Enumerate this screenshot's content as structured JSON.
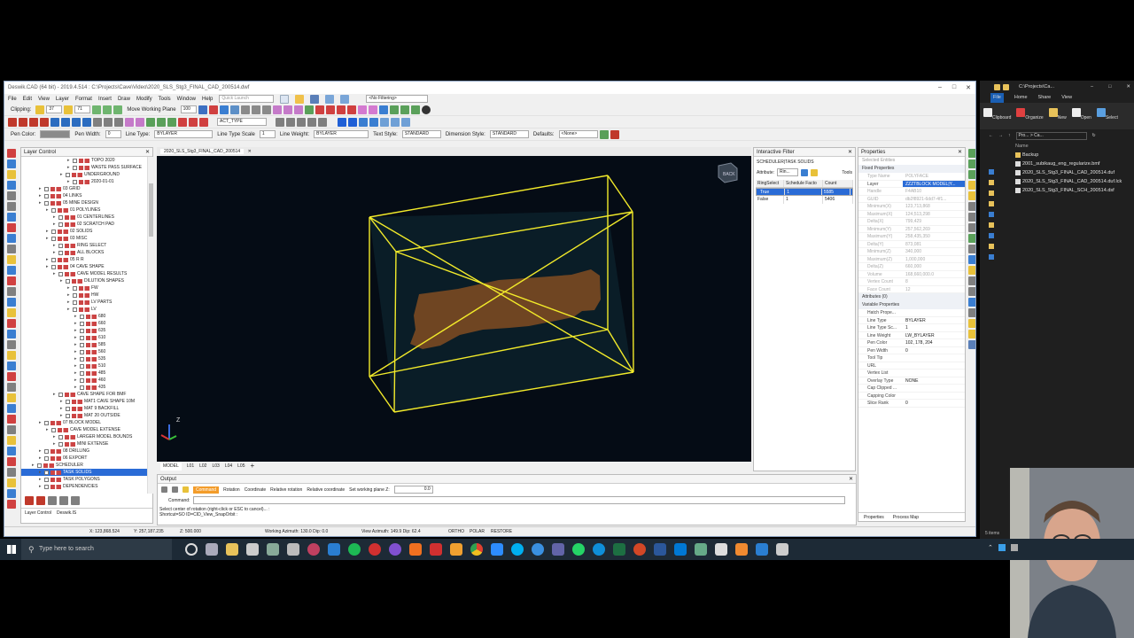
{
  "window": {
    "title": "Deswik.CAD (64 bit) - 2019.4.514 : C:\\Projects\\Cave\\Video\\2020_SLS_Stg3_FINAL_CAD_200514.dwf"
  },
  "menu": [
    "File",
    "Edit",
    "View",
    "Layer",
    "Format",
    "Insert",
    "Draw",
    "Modify",
    "Tools",
    "Window",
    "Help"
  ],
  "toolbar": {
    "quick_launch_placeholder": "Quick Launch",
    "filter": "<No Filtering>",
    "clipping_label": "Clipping:",
    "clip_a": "37",
    "clip_b": "71",
    "move_working_plane": "Move Working Plane",
    "zoom": "100",
    "act_type": "ACT_TYPE",
    "pen_color_label": "Pen Color:",
    "pen_width_label": "Pen Width:",
    "pen_width": "0",
    "line_type_label": "Line Type:",
    "line_type": "BYLAYER",
    "line_type_scale_label": "Line Type Scale",
    "line_type_scale": "1",
    "line_weight_label": "Line Weight:",
    "line_weight": "BYLAYER",
    "text_style_label": "Text Style:",
    "text_style": "STANDARD",
    "dim_style_label": "Dimension Style:",
    "dim_style": "STANDARD",
    "defaults_label": "Defaults:",
    "defaults": "<None>"
  },
  "layer_control": {
    "title": "Layer Control",
    "items": [
      {
        "label": "TOPO 2020",
        "indent": 6
      },
      {
        "label": "WASTE PASS SURFACE",
        "indent": 6
      },
      {
        "label": "UNDERGROUND",
        "indent": 5
      },
      {
        "label": "2020-01-01",
        "indent": 6
      },
      {
        "label": "03 GRID",
        "indent": 2
      },
      {
        "label": "04 LINKS",
        "indent": 2
      },
      {
        "label": "05 MINE DESIGN",
        "indent": 2
      },
      {
        "label": "01 POLYLINES",
        "indent": 3
      },
      {
        "label": "01 CENTERLINES",
        "indent": 4
      },
      {
        "label": "02 SCRATCH PAD",
        "indent": 4
      },
      {
        "label": "02 SOLIDS",
        "indent": 3
      },
      {
        "label": "03 MISC",
        "indent": 3
      },
      {
        "label": "RING SELECT",
        "indent": 4
      },
      {
        "label": "ALL BLOCKS",
        "indent": 4
      },
      {
        "label": "05 R R",
        "indent": 3
      },
      {
        "label": "04 CAVE SHAPE",
        "indent": 3
      },
      {
        "label": "CAVE MODEL RESULTS",
        "indent": 4
      },
      {
        "label": "DILUTION SHAPES",
        "indent": 5
      },
      {
        "label": "FW",
        "indent": 6
      },
      {
        "label": "HW",
        "indent": 6
      },
      {
        "label": "LV PARTS",
        "indent": 6
      },
      {
        "label": "LV",
        "indent": 6
      },
      {
        "label": "680",
        "indent": 7
      },
      {
        "label": "660",
        "indent": 7
      },
      {
        "label": "635",
        "indent": 7
      },
      {
        "label": "610",
        "indent": 7
      },
      {
        "label": "585",
        "indent": 7
      },
      {
        "label": "560",
        "indent": 7
      },
      {
        "label": "535",
        "indent": 7
      },
      {
        "label": "510",
        "indent": 7
      },
      {
        "label": "485",
        "indent": 7
      },
      {
        "label": "460",
        "indent": 7
      },
      {
        "label": "435",
        "indent": 7
      },
      {
        "label": "CAVE SHAPE FOR BMF",
        "indent": 4
      },
      {
        "label": "MAT1 CAVE SHAPE 10M",
        "indent": 5
      },
      {
        "label": "MAT 9 BACKFILL",
        "indent": 5
      },
      {
        "label": "MAT 20 OUTSIDE",
        "indent": 5
      },
      {
        "label": "07 BLOCK MODEL",
        "indent": 2
      },
      {
        "label": "CAVE MODEL EXTENSE",
        "indent": 3
      },
      {
        "label": "LARGER MODEL BOUNDS",
        "indent": 4
      },
      {
        "label": "MINI EXTENSE",
        "indent": 4
      },
      {
        "label": "08 DRILLING",
        "indent": 2
      },
      {
        "label": "06 EXPORT",
        "indent": 2
      },
      {
        "label": "SCHEDULER",
        "indent": 1
      },
      {
        "label": "TASK SOLIDS",
        "indent": 2,
        "selected": true
      },
      {
        "label": "TASK POLYGONS",
        "indent": 2
      },
      {
        "label": "DEPENDENCIES",
        "indent": 2
      }
    ],
    "bottom_tabs": [
      "Layer Control",
      "Deswik.IS"
    ]
  },
  "viewport": {
    "tab": "2020_SLS_Stg3_FINAL_CAD_200514",
    "axis_label": "Z",
    "nav_cube_label": "BACK",
    "model_tabs": [
      "MODEL",
      "L01",
      "L02",
      "L03",
      "L04",
      "L05",
      "+"
    ]
  },
  "interactive_filter": {
    "title": "Interactive Filter",
    "subtitle": "SCHEDULER|TASK SOLIDS",
    "attribute_label": "Attribute:",
    "attribute": "Rin...",
    "tools_label": "Tools",
    "columns": [
      "RingSelect",
      "Schedule Facto",
      "Count"
    ],
    "rows": [
      {
        "c1": "True",
        "c2": "1",
        "c3": "5585",
        "selected": true
      },
      {
        "c1": "False",
        "c2": "1",
        "c3": "5406",
        "selected": false
      }
    ]
  },
  "properties": {
    "title": "Properties",
    "selected_entities": "Selected Entities",
    "fixed_section": "Fixed Properties",
    "fixed": [
      {
        "k": "Type Name",
        "v": "POLYFACE",
        "grey": true
      },
      {
        "k": "Layer",
        "v": "ZZZTBLOCK MODEL|Y...",
        "grey": false,
        "highlight": true
      },
      {
        "k": "Handle",
        "v": "F4AB10",
        "grey": true
      },
      {
        "k": "GUID",
        "v": "db2f8921-6dd7-4f1...",
        "grey": true
      },
      {
        "k": "Minimum(X)",
        "v": "123,713,868",
        "grey": true
      },
      {
        "k": "Maximum(X)",
        "v": "124,513,298",
        "grey": true
      },
      {
        "k": "Delta(X)",
        "v": "799,429",
        "grey": true
      },
      {
        "k": "Minimum(Y)",
        "v": "257,562,269",
        "grey": true
      },
      {
        "k": "Maximum(Y)",
        "v": "258,435,350",
        "grey": true
      },
      {
        "k": "Delta(Y)",
        "v": "873,081",
        "grey": true
      },
      {
        "k": "Minimum(Z)",
        "v": "340,000",
        "grey": true
      },
      {
        "k": "Maximum(Z)",
        "v": "1,000,000",
        "grey": true
      },
      {
        "k": "Delta(Z)",
        "v": "660,000",
        "grey": true
      },
      {
        "k": "Volume",
        "v": "168,660,000.0",
        "grey": true
      },
      {
        "k": "Vertex Count",
        "v": "8",
        "grey": true
      },
      {
        "k": "Face Count",
        "v": "12",
        "grey": true
      }
    ],
    "attributes_section": "Attributes (0)",
    "variable_section": "Variable Properties",
    "variable": [
      {
        "k": "Hatch Prope...",
        "v": ""
      },
      {
        "k": "Line Type",
        "v": "BYLAYER"
      },
      {
        "k": "Line Type Sc...",
        "v": "1"
      },
      {
        "k": "Line Weight",
        "v": "LW_BYLAYER"
      },
      {
        "k": "Pen Color",
        "v": "102, 178, 204"
      },
      {
        "k": "Pen Width",
        "v": "0"
      },
      {
        "k": "Tool Tip",
        "v": ""
      },
      {
        "k": "URL",
        "v": ""
      },
      {
        "k": "Vertex List",
        "v": ""
      },
      {
        "k": "Overlay Type",
        "v": "NONE"
      },
      {
        "k": "Cap Clipped ...",
        "v": ""
      },
      {
        "k": "Capping Color",
        "v": ""
      },
      {
        "k": "Slice Rank",
        "v": "0"
      }
    ],
    "bottom_tabs": [
      "Properties",
      "Process Map"
    ]
  },
  "output": {
    "title": "Output",
    "command_btn": "Command",
    "rotation_btn": "Rotation",
    "coordinate_btn": "Coordinate",
    "relative_rotation_btn": "Relative rotation",
    "relative_coordinate_btn": "Relative coordinate",
    "working_plane_label": "Set working plane Z:",
    "working_plane_value": "0.0",
    "command_label": "Command:",
    "line1": "Select center of rotation (right-click or ESC to cancel)... :",
    "line2": "Shortcut=SO ID=CID_View_SnapOrbit :"
  },
  "status": {
    "x": "X: 123,868.524",
    "y": "Y: 257,187.235",
    "z": "Z: 500.000",
    "working_azimuth": "Working Azimuth: 130.0 Dip: 0.0",
    "view_azimuth": "View Azimuth: 149.9 Dip: 62.4",
    "ortho": "ORTHO",
    "polar": "POLAR",
    "restore": "RESTORE"
  },
  "explorer": {
    "path": "C:\\Projects\\Ca...",
    "tabs": [
      "File",
      "Home",
      "Share",
      "View"
    ],
    "ribbon": [
      "Clipboard",
      "Organize",
      "New",
      "Open",
      "Select"
    ],
    "address": "Pro... > Ca...",
    "name_header": "Name",
    "files": [
      "Backup",
      "2001_subikaug_eng_regularize.bmf",
      "2020_SLS_Stg3_FINAL_CAD_200514.duf",
      "2020_SLS_Stg3_FINAL_CAD_200514.duf.lck",
      "2020_SLS_Stg3_FINAL_SCH_200514.dsf"
    ],
    "items_count": "5 items"
  },
  "taskbar": {
    "search_placeholder": "Type here to search"
  },
  "colors": {
    "viewport_bg": "#050c15",
    "box_wire": "#f2ea2a",
    "solid": "#7a4a22",
    "selection": "#2a6bd6"
  }
}
